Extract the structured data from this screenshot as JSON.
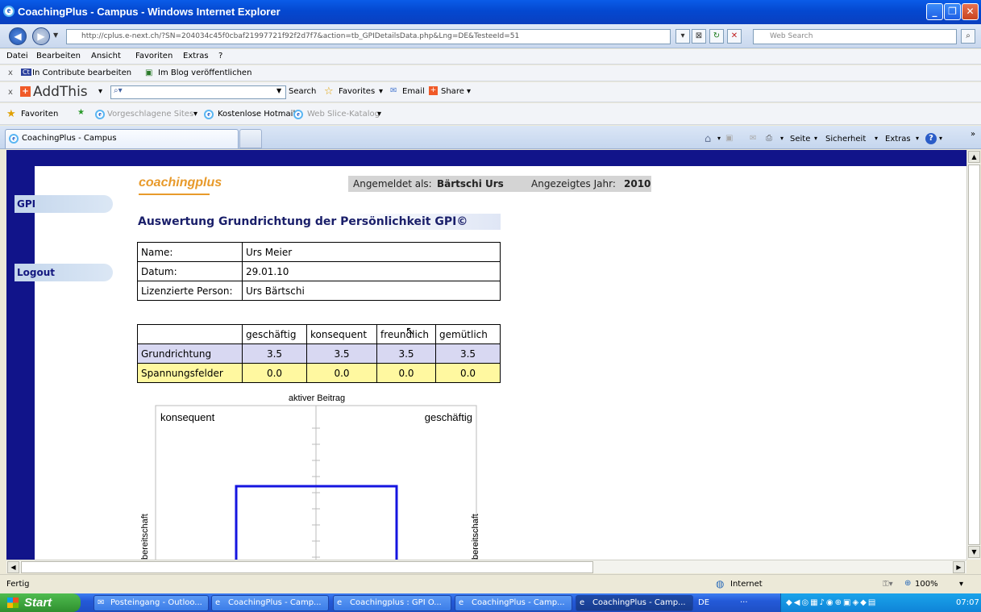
{
  "window": {
    "title": "CoachingPlus - Campus - Windows Internet Explorer",
    "controls": [
      "_",
      "❐",
      "✕"
    ]
  },
  "address_bar": {
    "url": "http://cplus.e-next.ch/?SN=204034c45f0cbaf21997721f92f2d7f7&action=tb_GPIDetailsData.php&Lng=DE&TesteeId=51",
    "search_placeholder": "Web Search"
  },
  "menu": {
    "items": [
      "Datei",
      "Bearbeiten",
      "Ansicht",
      "Favoriten",
      "Extras",
      "?"
    ]
  },
  "contribute_bar": {
    "edit_label": "In Contribute bearbeiten",
    "blog_label": "Im Blog veröffentlichen"
  },
  "addthis_bar": {
    "brand": "AddThis",
    "search": "Search",
    "favorites": "Favorites",
    "email": "Email",
    "share": "Share"
  },
  "favorites_bar": {
    "favorites": "Favoriten",
    "suggested": "Vorgeschlagene Sites",
    "hotmail": "Kostenlose Hotmail",
    "webslice": "Web Slice-Katalog"
  },
  "tab": {
    "title": "CoachingPlus - Campus"
  },
  "command_bar": {
    "seite": "Seite",
    "sicherheit": "Sicherheit",
    "extras": "Extras"
  },
  "page": {
    "logo": "coachingplus",
    "nav": {
      "gpi": "GPI",
      "logout": "Logout"
    },
    "login": {
      "label": "Angemeldet als:",
      "user": "Bärtschi Urs",
      "year_label": "Angezeigtes Jahr:",
      "year": "2010"
    },
    "title": "Auswertung Grundrichtung der Persönlichkeit GPI©",
    "info": [
      {
        "label": "Name:",
        "value": "Urs Meier"
      },
      {
        "label": "Datum:",
        "value": "29.01.10"
      },
      {
        "label": "Lizenzierte Person:",
        "value": "Urs Bärtschi"
      }
    ],
    "scores": {
      "headers": [
        "",
        "geschäftig",
        "konsequent",
        "freundlich",
        "gemütlich"
      ],
      "rows": [
        {
          "label": "Grundrichtung",
          "values": [
            "3.5",
            "3.5",
            "3.5",
            "3.5"
          ]
        },
        {
          "label": "Spannungsfelder",
          "values": [
            "0.0",
            "0.0",
            "0.0",
            "0.0"
          ]
        }
      ]
    },
    "diagram": {
      "top_label": "aktiver Beitrag",
      "top_left": "konsequent",
      "top_right": "geschäftig",
      "left_label": "bereitschaft",
      "right_label": "bereitschaft",
      "line_color": "#1515e0"
    }
  },
  "status_bar": {
    "status": "Fertig",
    "zone": "Internet",
    "zoom": "100%"
  },
  "taskbar": {
    "start": "Start",
    "items": [
      "Posteingang - Outloo...",
      "CoachingPlus - Camp...",
      "Coachingplus : GPI O...",
      "CoachingPlus - Camp...",
      "CoachingPlus - Camp..."
    ],
    "lang": "DE",
    "clock": "07:07"
  }
}
